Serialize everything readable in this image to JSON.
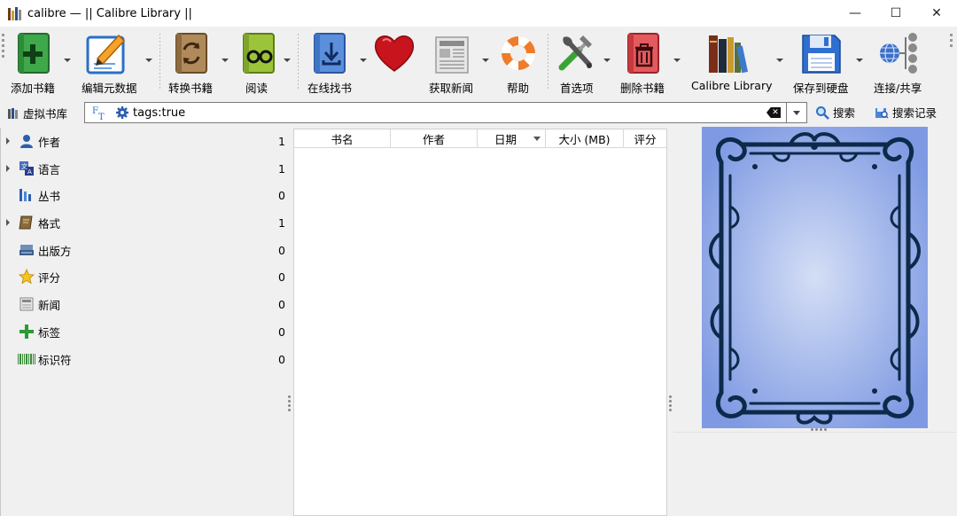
{
  "window": {
    "title": "calibre — || Calibre Library ||",
    "minimize": "—",
    "maximize": "☐",
    "close": "✕"
  },
  "toolbar": {
    "items": [
      {
        "label": "添加书籍",
        "icon": "add-book-icon"
      },
      {
        "label": "编辑元数据",
        "icon": "edit-metadata-icon"
      },
      {
        "label": "转换书籍",
        "icon": "convert-book-icon"
      },
      {
        "label": "阅读",
        "icon": "read-book-icon"
      },
      {
        "label": "在线找书",
        "icon": "get-books-icon"
      },
      {
        "label": "",
        "icon": "donate-heart-icon"
      },
      {
        "label": "获取新闻",
        "icon": "fetch-news-icon"
      },
      {
        "label": "帮助",
        "icon": "help-lifebuoy-icon"
      },
      {
        "label": "首选项",
        "icon": "preferences-tools-icon"
      },
      {
        "label": "删除书籍",
        "icon": "remove-book-icon"
      },
      {
        "label": "Calibre Library",
        "icon": "library-books-icon"
      },
      {
        "label": "保存到硬盘",
        "icon": "save-disk-icon"
      },
      {
        "label": "连接/共享",
        "icon": "connect-share-icon"
      }
    ]
  },
  "search": {
    "virtual_library": "虚拟书库",
    "query": "tags:true",
    "search_button": "搜索",
    "saved_search_button": "搜索记录"
  },
  "tag_browser": [
    {
      "label": "作者",
      "count": "1",
      "icon": "person-icon",
      "expandable": true
    },
    {
      "label": "语言",
      "count": "1",
      "icon": "language-icon",
      "expandable": true
    },
    {
      "label": "丛书",
      "count": "0",
      "icon": "series-icon",
      "expandable": false
    },
    {
      "label": "格式",
      "count": "1",
      "icon": "format-book-icon",
      "expandable": true
    },
    {
      "label": "出版方",
      "count": "0",
      "icon": "publisher-icon",
      "expandable": false
    },
    {
      "label": "评分",
      "count": "0",
      "icon": "star-icon",
      "expandable": false
    },
    {
      "label": "新闻",
      "count": "0",
      "icon": "news-icon",
      "expandable": false
    },
    {
      "label": "标签",
      "count": "0",
      "icon": "tag-plus-icon",
      "expandable": false
    },
    {
      "label": "标识符",
      "count": "0",
      "icon": "barcode-icon",
      "expandable": false
    }
  ],
  "book_list": {
    "columns": [
      "书名",
      "作者",
      "日期",
      "大小 (MB)",
      "评分"
    ],
    "sorted_column": "日期",
    "rows": []
  },
  "colors": {
    "cover_blue": "#7f9ae3",
    "cover_center": "#c9d6f3",
    "ornament": "#0d2a4a"
  }
}
